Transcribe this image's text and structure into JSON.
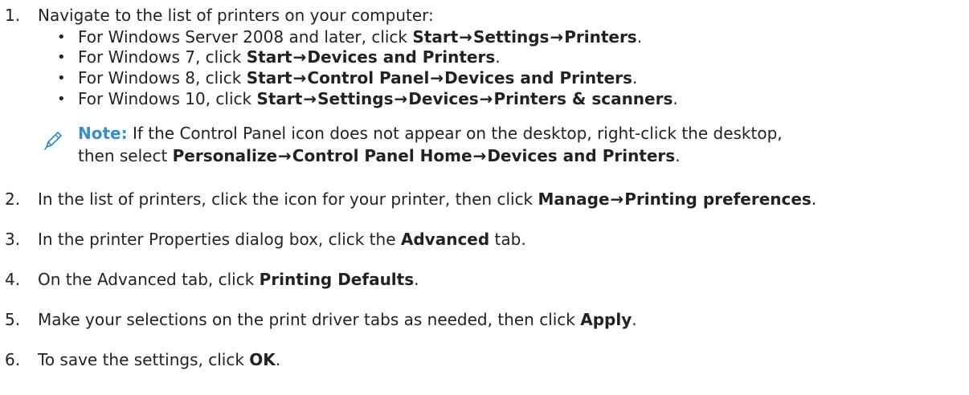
{
  "steps": [
    {
      "num": "1.",
      "text": "Navigate to the list of printers on your computer:",
      "subitems": [
        {
          "pre": "For Windows Server 2008 and later, click ",
          "path": [
            "Start",
            "Settings",
            "Printers"
          ],
          "post": "."
        },
        {
          "pre": "For Windows 7, click ",
          "path": [
            "Start",
            "Devices and Printers"
          ],
          "post": "."
        },
        {
          "pre": "For Windows 8, click ",
          "path": [
            "Start",
            "Control Panel",
            "Devices and Printers"
          ],
          "post": "."
        },
        {
          "pre": "For Windows 10, click ",
          "path": [
            "Start",
            "Settings",
            "Devices",
            "Printers & scanners"
          ],
          "post": "."
        }
      ]
    },
    {
      "num": "2.",
      "pre": "In the list of printers, click the icon for your printer, then click ",
      "path": [
        "Manage",
        "Printing preferences"
      ],
      "post": "."
    },
    {
      "num": "3.",
      "pre": "In the printer Properties dialog box, click the ",
      "bold": "Advanced",
      "post": " tab."
    },
    {
      "num": "4.",
      "pre": "On the Advanced tab, click ",
      "bold": "Printing Defaults",
      "post": "."
    },
    {
      "num": "5.",
      "pre": "Make your selections on the print driver tabs as needed, then click ",
      "bold": "Apply",
      "post": "."
    },
    {
      "num": "6.",
      "pre": "To save the settings, click ",
      "bold": "OK",
      "post": "."
    }
  ],
  "note": {
    "label": "Note:",
    "line1": " If the Control Panel icon does not appear on the desktop, right-click the desktop,",
    "line2_pre": "then select ",
    "path": [
      "Personalize",
      "Control Panel Home",
      "Devices and Printers"
    ],
    "line2_post": ".",
    "icon": "pencil-icon",
    "color": "#3a8ec8"
  },
  "arrow": "→",
  "bullet": "•"
}
